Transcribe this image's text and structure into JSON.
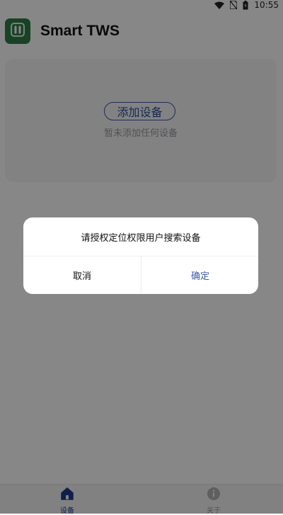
{
  "status_bar": {
    "time": "10:55",
    "icons": [
      "wifi-icon",
      "no-sim-icon",
      "battery-icon"
    ]
  },
  "header": {
    "title": "Smart TWS",
    "logo_icon": "earbuds-icon"
  },
  "device_card": {
    "add_button_label": "添加设备",
    "empty_hint": "暂未添加任何设备"
  },
  "dialog": {
    "message": "请授权定位权限用户搜索设备",
    "cancel_label": "取消",
    "confirm_label": "确定"
  },
  "bottom_nav": {
    "items": [
      {
        "label": "设备",
        "icon": "home-icon",
        "active": true
      },
      {
        "label": "关于",
        "icon": "info-icon",
        "active": false
      }
    ]
  },
  "colors": {
    "logo_bg": "#2f7d46",
    "accent": "#2e4a9e",
    "overlay": "rgba(0,0,0,0.47)"
  }
}
